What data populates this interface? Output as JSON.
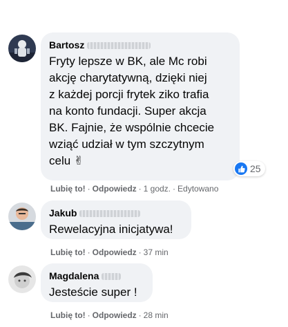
{
  "comments": [
    {
      "author": "Bartosz",
      "lines": [
        "Fryty lepsze w BK, ale Mc robi",
        "akcję charytatywną, dzięki niej",
        "z każdej porcji frytek ziko trafia",
        "na konto fundacji. Super akcja",
        "BK. Fajnie, że wspólnie chcecie",
        "wziąć udział w tym szczytnym",
        "celu ✌"
      ],
      "reaction_count": "25",
      "like_label": "Lubię to!",
      "reply_label": "Odpowiedz",
      "time": "1 godz.",
      "edited": "Edytowano"
    },
    {
      "author": "Jakub",
      "lines": [
        "Rewelacyjna inicjatywa!"
      ],
      "like_label": "Lubię to!",
      "reply_label": "Odpowiedz",
      "time": "37 min"
    },
    {
      "author": "Magdalena",
      "lines": [
        "Jesteście super !"
      ],
      "like_label": "Lubię to!",
      "reply_label": "Odpowiedz",
      "time": "28 min"
    }
  ],
  "separator": "·",
  "colors": {
    "bubble": "#f0f2f5",
    "meta": "#65676b",
    "like_blue": "#1877f2"
  }
}
